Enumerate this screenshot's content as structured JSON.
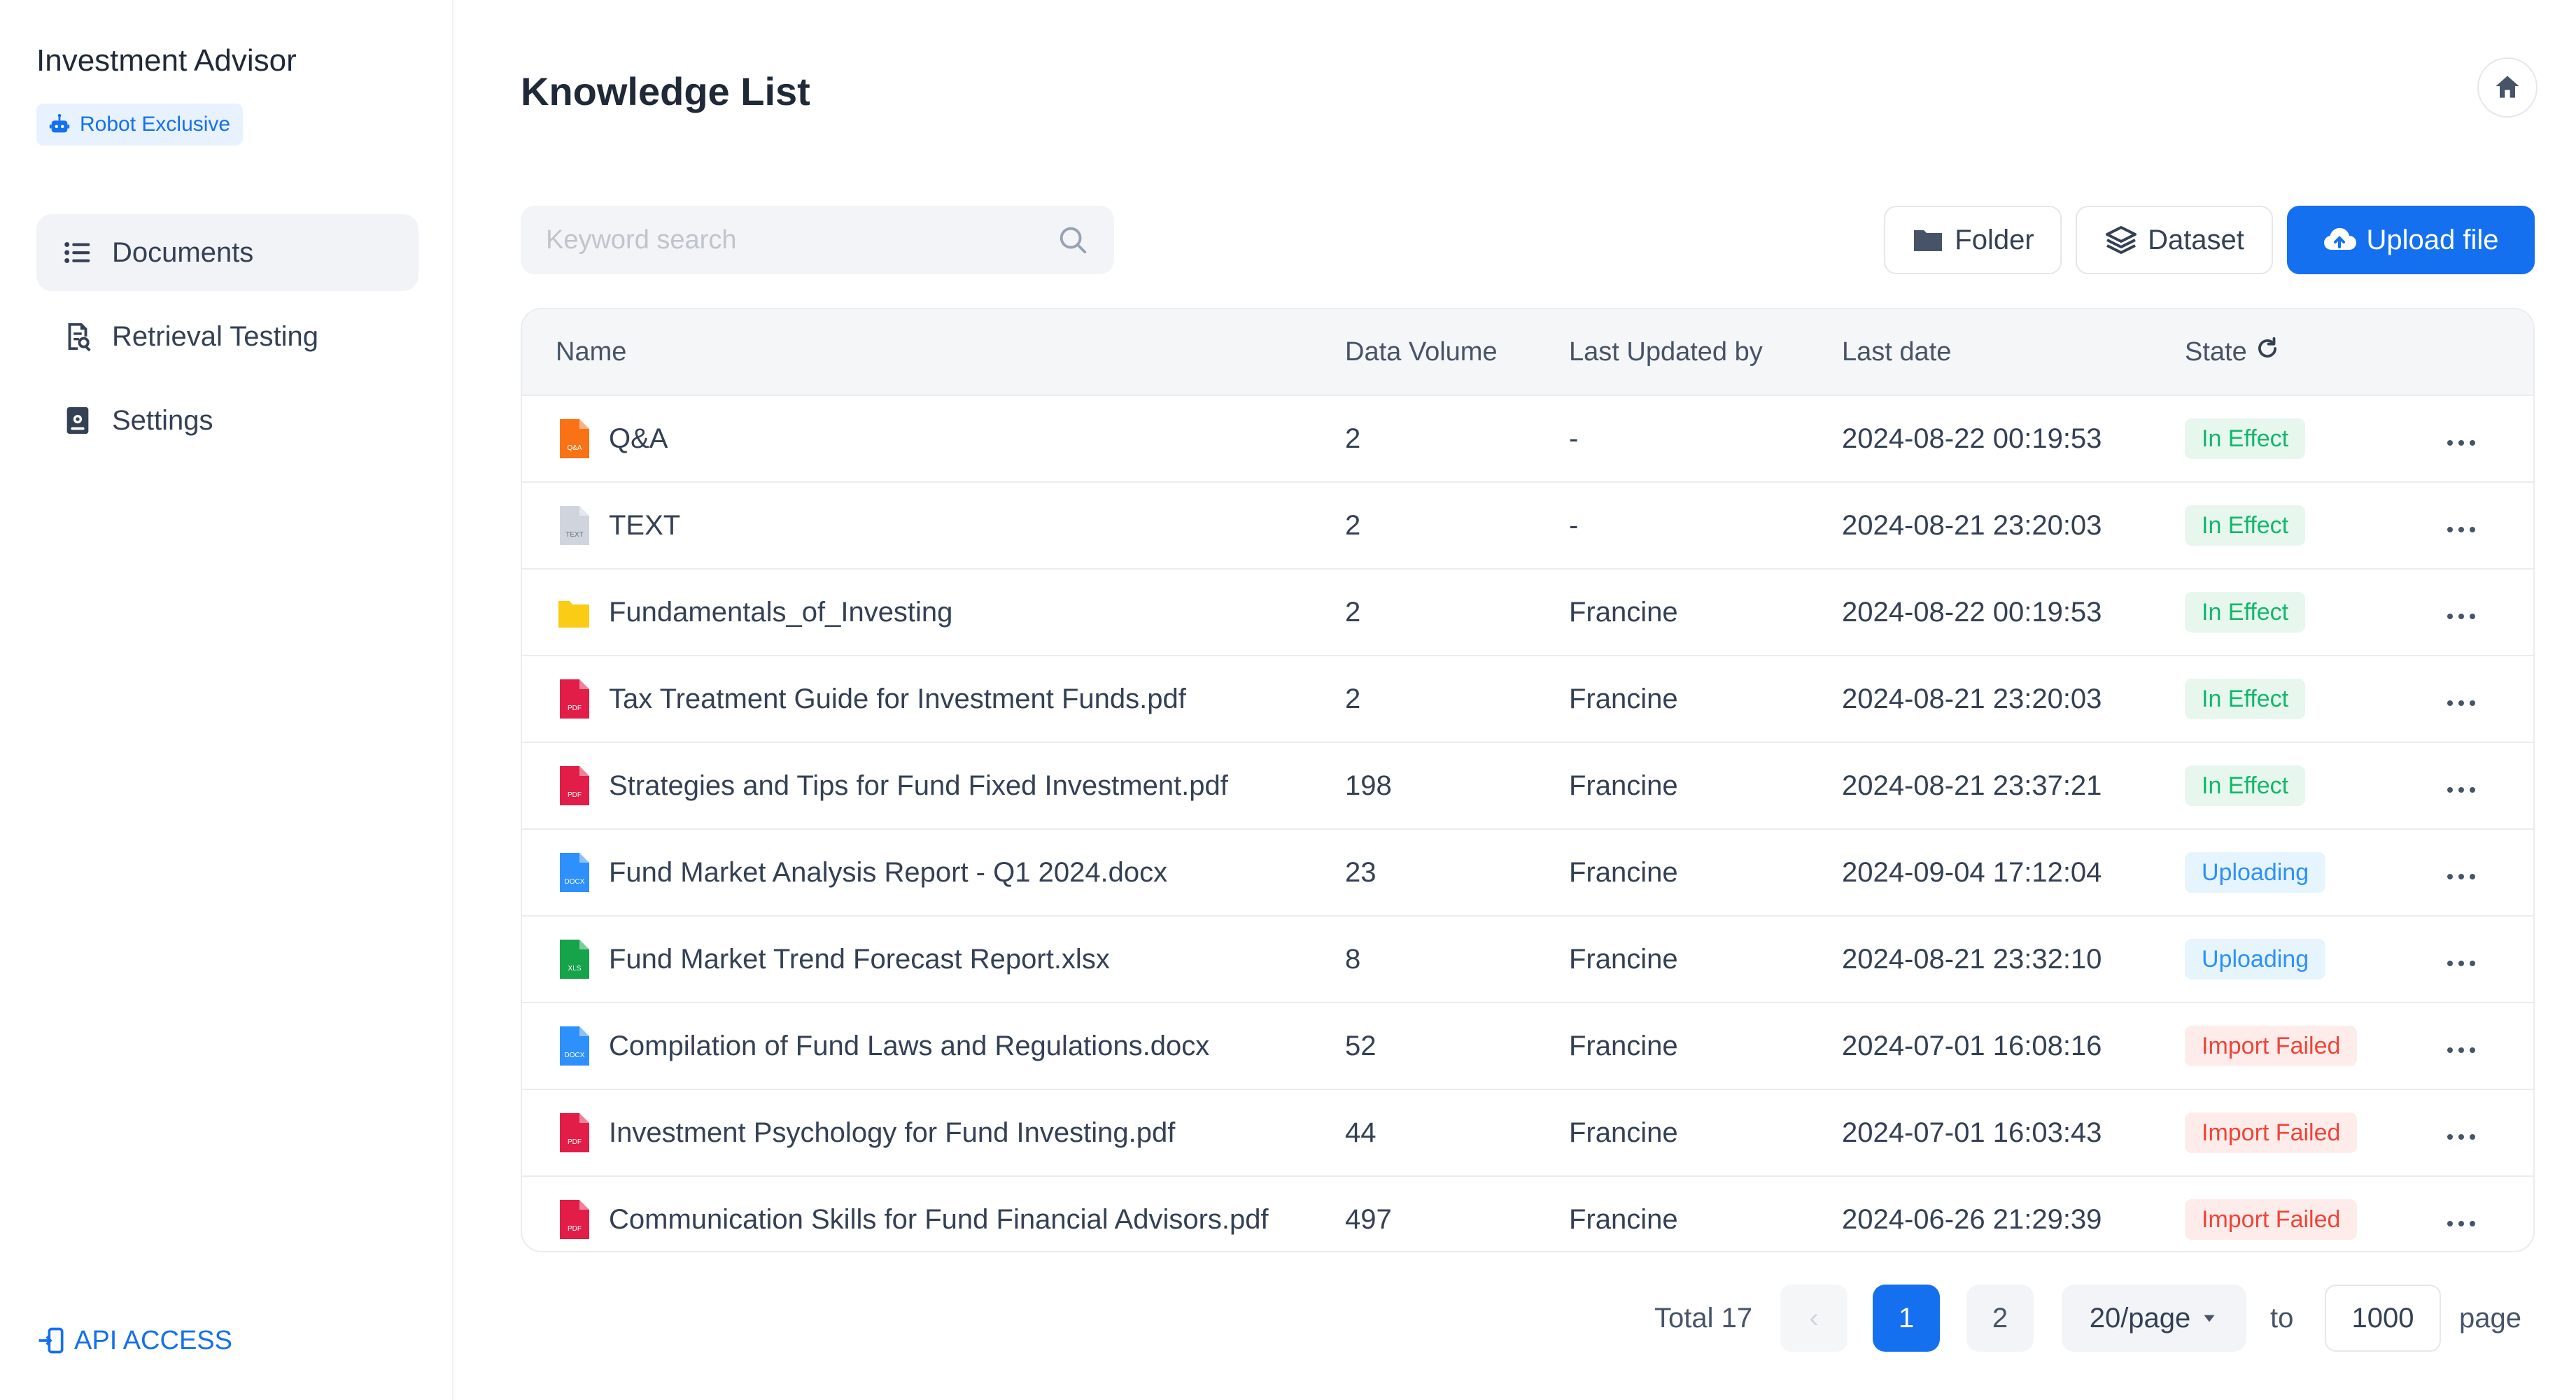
{
  "sidebar": {
    "app_title": "Investment Advisor",
    "badge": "Robot Exclusive",
    "items": [
      {
        "label": "Documents",
        "icon": "list-icon",
        "active": true
      },
      {
        "label": "Retrieval Testing",
        "icon": "document-search-icon",
        "active": false
      },
      {
        "label": "Settings",
        "icon": "settings-icon",
        "active": false
      }
    ],
    "api_access": "API ACCESS"
  },
  "header": {
    "title": "Knowledge List"
  },
  "toolbar": {
    "search_placeholder": "Keyword search",
    "folder_label": "Folder",
    "dataset_label": "Dataset",
    "upload_label": "Upload file"
  },
  "table": {
    "columns": [
      "Name",
      "Data Volume",
      "Last Updated by",
      "Last date",
      "State"
    ],
    "rows": [
      {
        "icon": "qa",
        "name": "Q&A",
        "volume": "2",
        "updated_by": "-",
        "date": "2024-08-22 00:19:53",
        "state": "In Effect",
        "state_type": "green"
      },
      {
        "icon": "text",
        "name": "TEXT",
        "volume": "2",
        "updated_by": "-",
        "date": "2024-08-21 23:20:03",
        "state": "In Effect",
        "state_type": "green"
      },
      {
        "icon": "folder",
        "name": "Fundamentals_of_Investing",
        "volume": "2",
        "updated_by": "Francine",
        "date": "2024-08-22 00:19:53",
        "state": "In Effect",
        "state_type": "green"
      },
      {
        "icon": "pdf",
        "name": "Tax Treatment Guide for Investment Funds.pdf",
        "volume": "2",
        "updated_by": "Francine",
        "date": "2024-08-21 23:20:03",
        "state": "In Effect",
        "state_type": "green"
      },
      {
        "icon": "pdf",
        "name": "Strategies and Tips for Fund Fixed Investment.pdf",
        "volume": "198",
        "updated_by": "Francine",
        "date": "2024-08-21 23:37:21",
        "state": "In Effect",
        "state_type": "green"
      },
      {
        "icon": "docx",
        "name": "Fund Market Analysis Report - Q1 2024.docx",
        "volume": "23",
        "updated_by": "Francine",
        "date": "2024-09-04 17:12:04",
        "state": "Uploading",
        "state_type": "blue"
      },
      {
        "icon": "xls",
        "name": "Fund Market Trend Forecast Report.xlsx",
        "volume": "8",
        "updated_by": "Francine",
        "date": "2024-08-21 23:32:10",
        "state": "Uploading",
        "state_type": "blue"
      },
      {
        "icon": "docx",
        "name": "Compilation of Fund Laws and Regulations.docx",
        "volume": "52",
        "updated_by": "Francine",
        "date": "2024-07-01 16:08:16",
        "state": "Import Failed",
        "state_type": "red"
      },
      {
        "icon": "pdf",
        "name": "Investment Psychology for Fund Investing.pdf",
        "volume": "44",
        "updated_by": "Francine",
        "date": "2024-07-01 16:03:43",
        "state": "Import Failed",
        "state_type": "red"
      },
      {
        "icon": "pdf",
        "name": "Communication Skills for Fund Financial Advisors.pdf",
        "volume": "497",
        "updated_by": "Francine",
        "date": "2024-06-26 21:29:39",
        "state": "Import Failed",
        "state_type": "red"
      }
    ]
  },
  "pagination": {
    "total": "Total 17",
    "prev": "‹",
    "pages": [
      "1",
      "2"
    ],
    "current": "1",
    "page_size": "20/page",
    "to_label": "to",
    "jump_value": "1000",
    "page_label": "page"
  },
  "colors": {
    "accent": "#1570ef",
    "green": "#12b76a",
    "blue": "#2e90fa",
    "red": "#f04438"
  }
}
